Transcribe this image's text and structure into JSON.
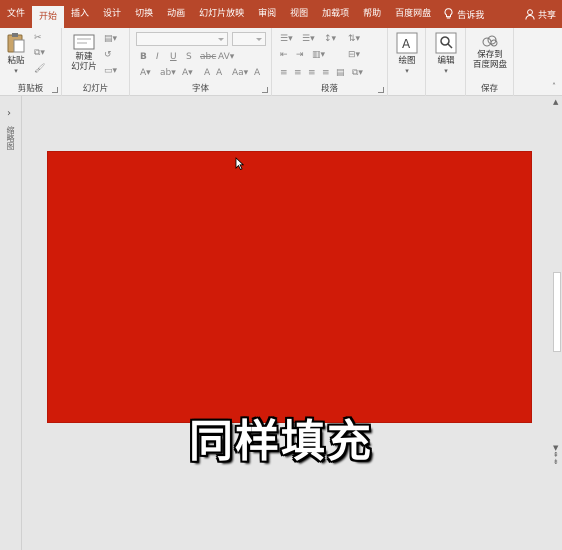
{
  "tabs": [
    {
      "label": "文件",
      "active": false
    },
    {
      "label": "开始",
      "active": true
    },
    {
      "label": "插入",
      "active": false
    },
    {
      "label": "设计",
      "active": false
    },
    {
      "label": "切换",
      "active": false
    },
    {
      "label": "动画",
      "active": false
    },
    {
      "label": "幻灯片放映",
      "active": false
    },
    {
      "label": "审阅",
      "active": false
    },
    {
      "label": "视图",
      "active": false
    },
    {
      "label": "加载项",
      "active": false
    },
    {
      "label": "帮助",
      "active": false
    },
    {
      "label": "百度网盘",
      "active": false
    }
  ],
  "tell_me": "告诉我",
  "share": "共享",
  "groups": {
    "clipboard": {
      "label": "剪贴板",
      "paste": "粘贴"
    },
    "slides": {
      "label": "幻灯片",
      "new_slide_1": "新建",
      "new_slide_2": "幻灯片"
    },
    "font": {
      "label": "字体"
    },
    "paragraph": {
      "label": "段落"
    },
    "drawing": {
      "label": "",
      "draw": "绘图"
    },
    "editing": {
      "label": "",
      "edit": "编辑"
    },
    "save": {
      "label": "保存",
      "save_1": "保存到",
      "save_2": "百度网盘"
    }
  },
  "sidepane_label": "缩略图",
  "subtitle": "同样填充",
  "colors": {
    "ribbon_tab": "#b7472a",
    "slide_fill": "#d01b08"
  }
}
